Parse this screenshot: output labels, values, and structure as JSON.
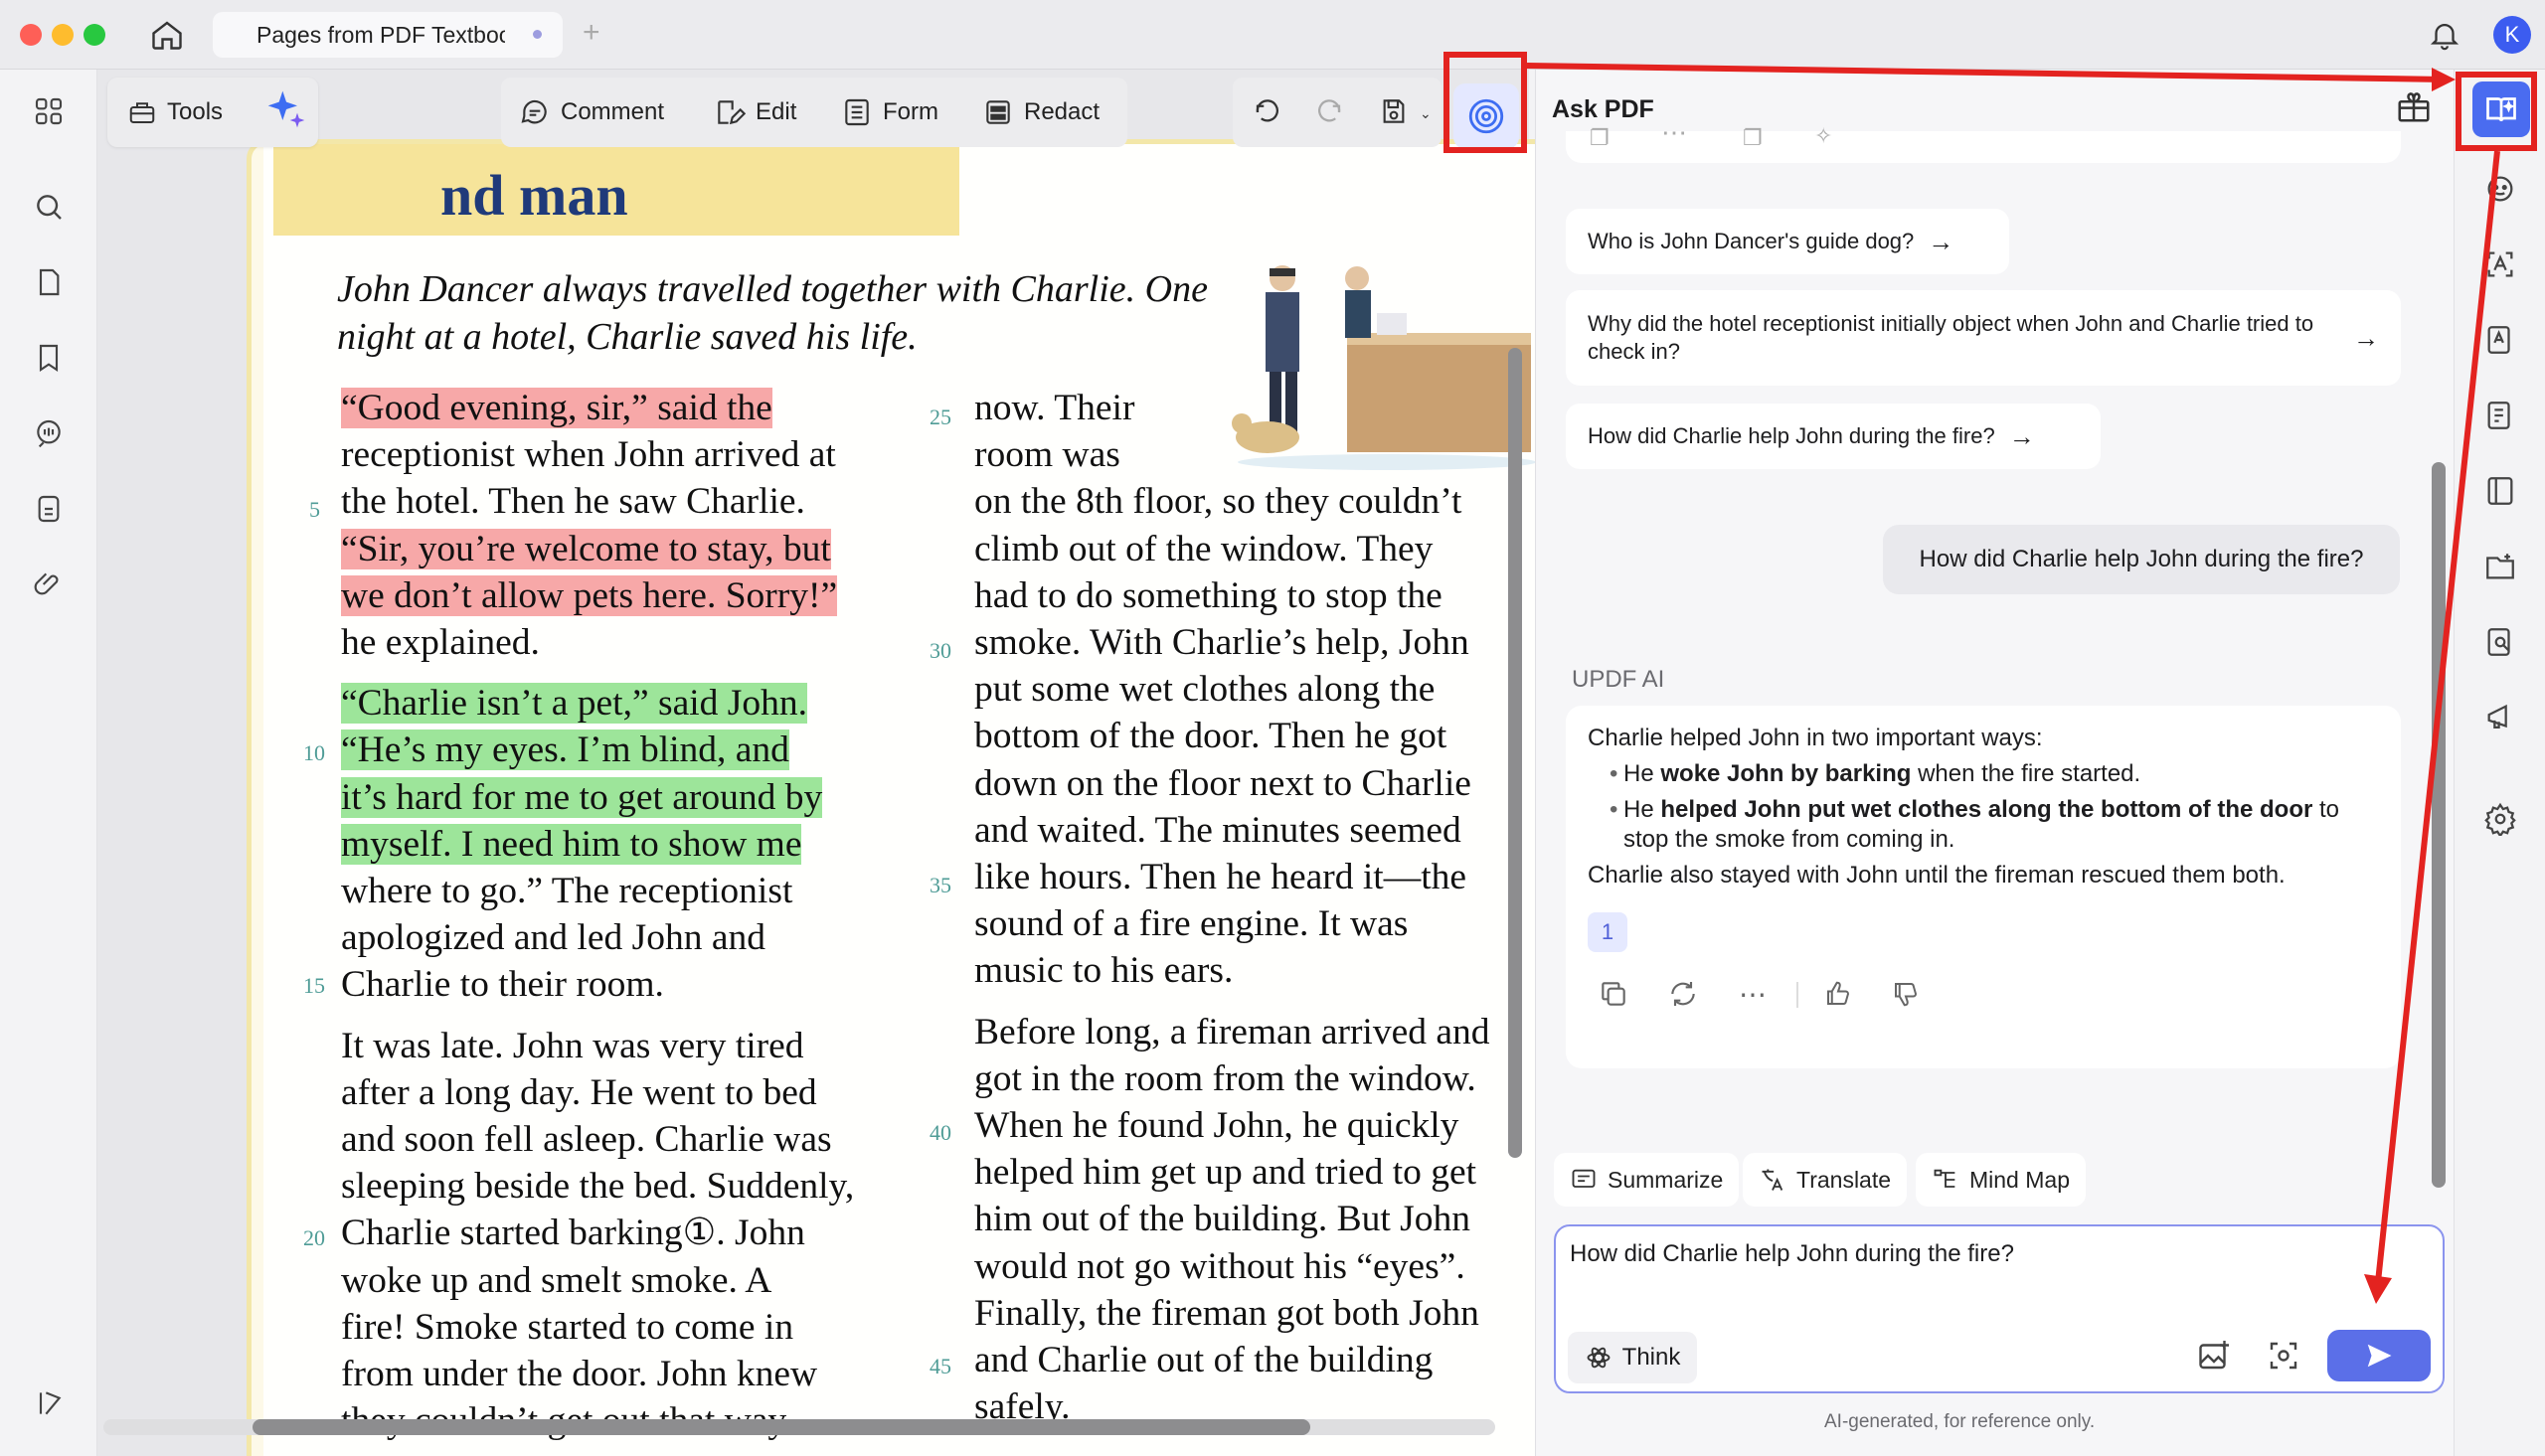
{
  "window": {
    "tab_title": "Pages from PDF Textbook",
    "avatar_letter": "K"
  },
  "toolbar": {
    "tools_label": "Tools",
    "comment_label": "Comment",
    "edit_label": "Edit",
    "form_label": "Form",
    "redact_label": "Redact"
  },
  "document": {
    "heading": "nd man",
    "intro": "John Dancer always travelled together with Charlie. One night at a hotel, Charlie saved his life.",
    "left_column": {
      "p1_lines": [
        "“Good evening, sir,” said the",
        "receptionist when John arrived at",
        "the hotel. Then he saw Charlie.",
        "“Sir, you’re welcome to stay, but",
        "we don’t allow pets here. Sorry!”",
        "he explained."
      ],
      "p2_lines": [
        "“Charlie isn’t a pet,” said John.",
        "“He’s my eyes. I’m blind, and",
        "it’s hard for me to get around by",
        "myself. I need him to show me",
        "where to go.” The receptionist",
        "apologized and led John and",
        "Charlie to their room."
      ],
      "p3_lines": [
        "It was late. John was very tired",
        "after a long day. He went to bed",
        "and soon fell asleep. Charlie was",
        "sleeping beside the bed. Suddenly,",
        "Charlie started barking①. John",
        "woke up and smelt smoke. A",
        "fire! Smoke started to come in",
        "from under the door. John knew",
        "they couldn’t get out that way"
      ]
    },
    "right_column": {
      "p1_lines": [
        "now. Their",
        "room was",
        "on the 8th floor, so they couldn’t",
        "climb out of the window. They",
        "had to do something to stop the",
        "smoke. With Charlie’s help, John",
        "put some wet clothes along the",
        "bottom of the door. Then he got",
        "down on the floor next to Charlie",
        "and waited. The minutes seemed",
        "like hours. Then he heard it—the",
        "sound of a fire engine. It was",
        "music to his ears."
      ],
      "p2_lines": [
        "Before long, a fireman arrived and",
        "got in the room from the window.",
        "When he found John, he quickly",
        "helped him get up and tried to get",
        "him out of the building. But John",
        "would not go without his “eyes”.",
        "Finally, the fireman got both John",
        "and Charlie out of the building",
        "safely."
      ]
    },
    "line_numbers": {
      "n5": "5",
      "n10": "10",
      "n15": "15",
      "n20": "20",
      "n25": "25",
      "n30": "30",
      "n35": "35",
      "n40": "40",
      "n45": "45"
    }
  },
  "chat": {
    "title": "Ask PDF",
    "suggestions": [
      "Who is John Dancer's guide dog?",
      "Why did the hotel receptionist initially object when John and Charlie tried to check in?",
      "How did Charlie help John during the fire?"
    ],
    "user_message": "How did Charlie help John during the fire?",
    "ai_label": "UPDF AI",
    "ai_answer": {
      "intro": "Charlie helped John in two important ways:",
      "b1_pre": "He ",
      "b1_bold": "woke John by barking",
      "b1_post": " when the fire started.",
      "b2_pre": "He ",
      "b2_bold": "helped John put wet clothes along the bottom of the door",
      "b2_post": " to stop the smoke from coming in.",
      "outro": "Charlie also stayed with John until the fireman rescued them both.",
      "reference": "1"
    },
    "quick_actions": {
      "summarize": "Summarize",
      "translate": "Translate",
      "mind_map": "Mind Map"
    },
    "input_value": "How did Charlie help John during the fire?",
    "think_label": "Think",
    "footer_note": "AI-generated, for reference only."
  },
  "colors": {
    "accent": "#5b6fe8",
    "annotation_red": "#e32320",
    "highlight_red": "#f7a8a8",
    "highlight_green": "#9de59a"
  }
}
